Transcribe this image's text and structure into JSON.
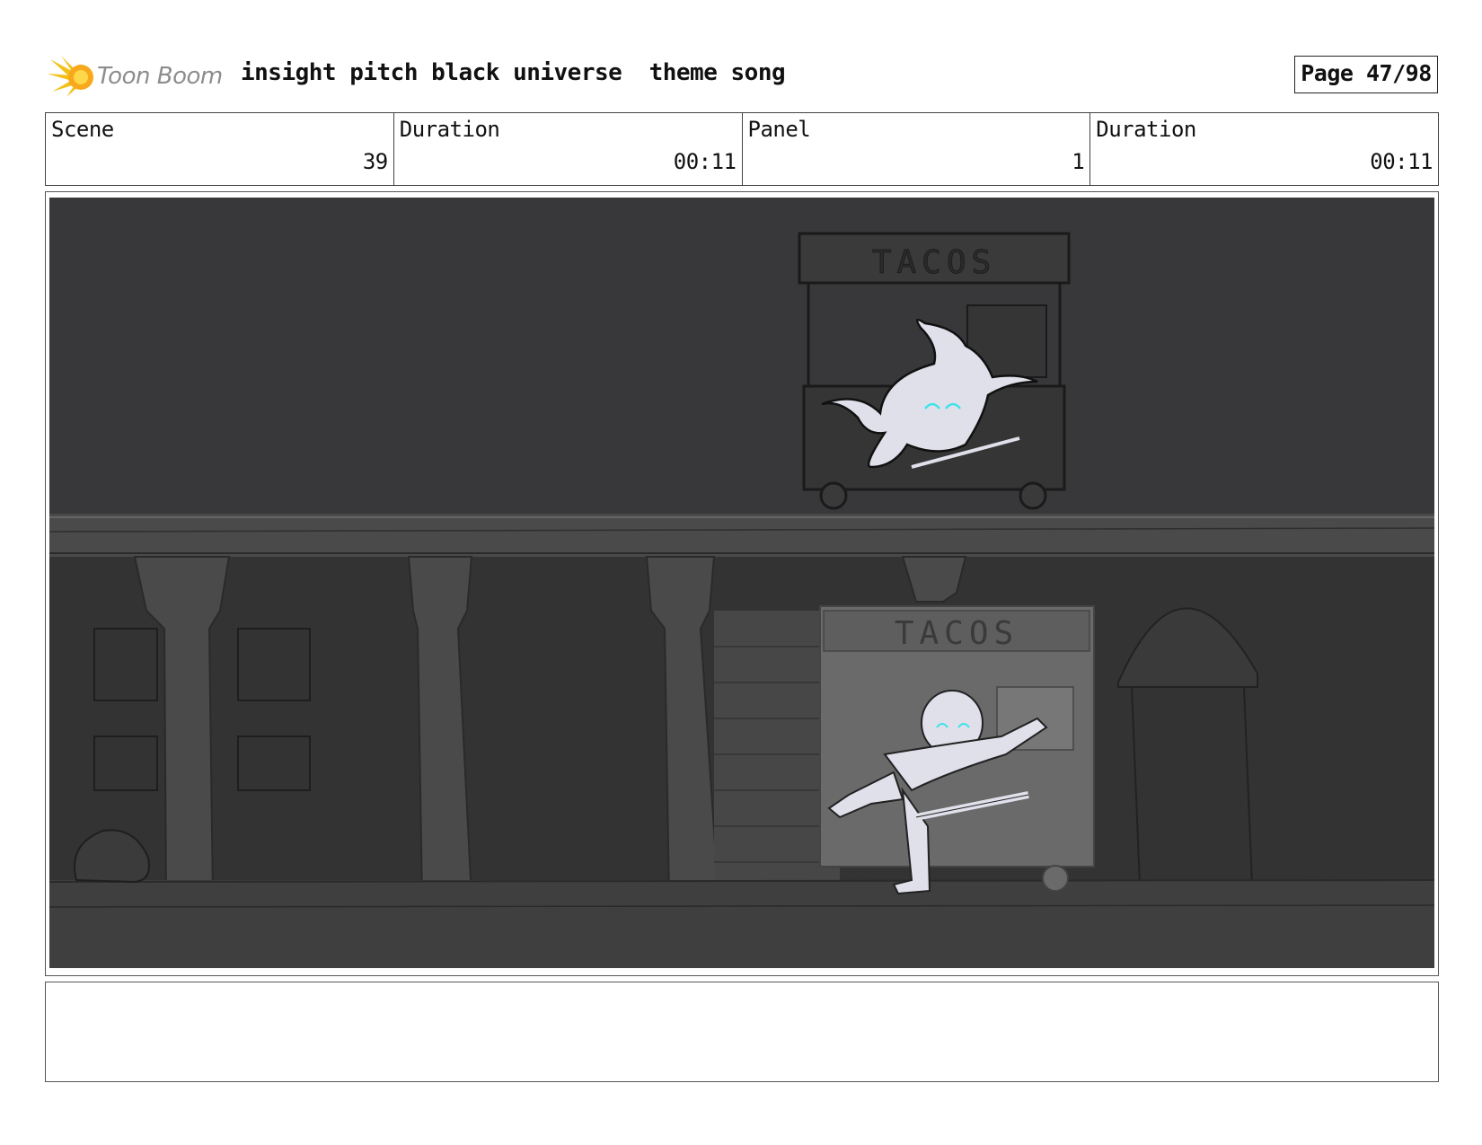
{
  "header": {
    "brand": "Toon Boom",
    "title": "insight pitch black universe  theme song",
    "page_label": "Page 47/98"
  },
  "info": [
    {
      "label": "Scene",
      "value": "39"
    },
    {
      "label": "Duration",
      "value": "00:11"
    },
    {
      "label": "Panel",
      "value": "1"
    },
    {
      "label": "Duration",
      "value": "00:11"
    }
  ],
  "panel": {
    "sign_upper": "TACOS",
    "sign_lower": "TACOS"
  },
  "notes": {
    "text": ""
  },
  "colors": {
    "sky": "#3a3a3e",
    "street": "#3e3e3e",
    "accent_glow": "#3fe3e8",
    "logo_yellow": "#f2c21b"
  }
}
